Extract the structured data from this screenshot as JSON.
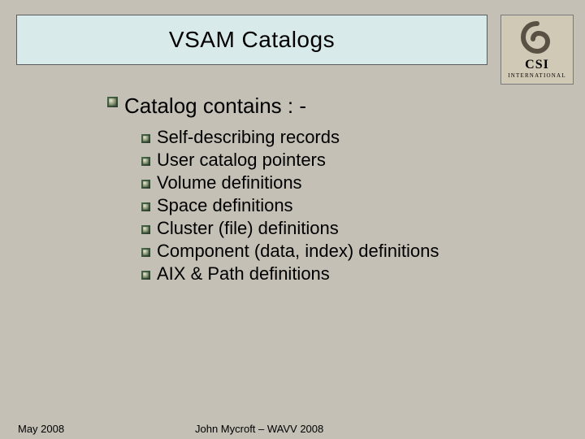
{
  "title": "VSAM Catalogs",
  "logo": {
    "name": "CSI",
    "sub": "INTERNATIONAL"
  },
  "main": {
    "heading": "Catalog contains : -",
    "items": [
      "Self-describing records",
      "User catalog pointers",
      "Volume definitions",
      "Space definitions",
      "Cluster (file) definitions",
      "Component (data, index) definitions",
      "AIX & Path definitions"
    ]
  },
  "footer": {
    "date": "May 2008",
    "author": "John Mycroft – WAVV 2008"
  }
}
